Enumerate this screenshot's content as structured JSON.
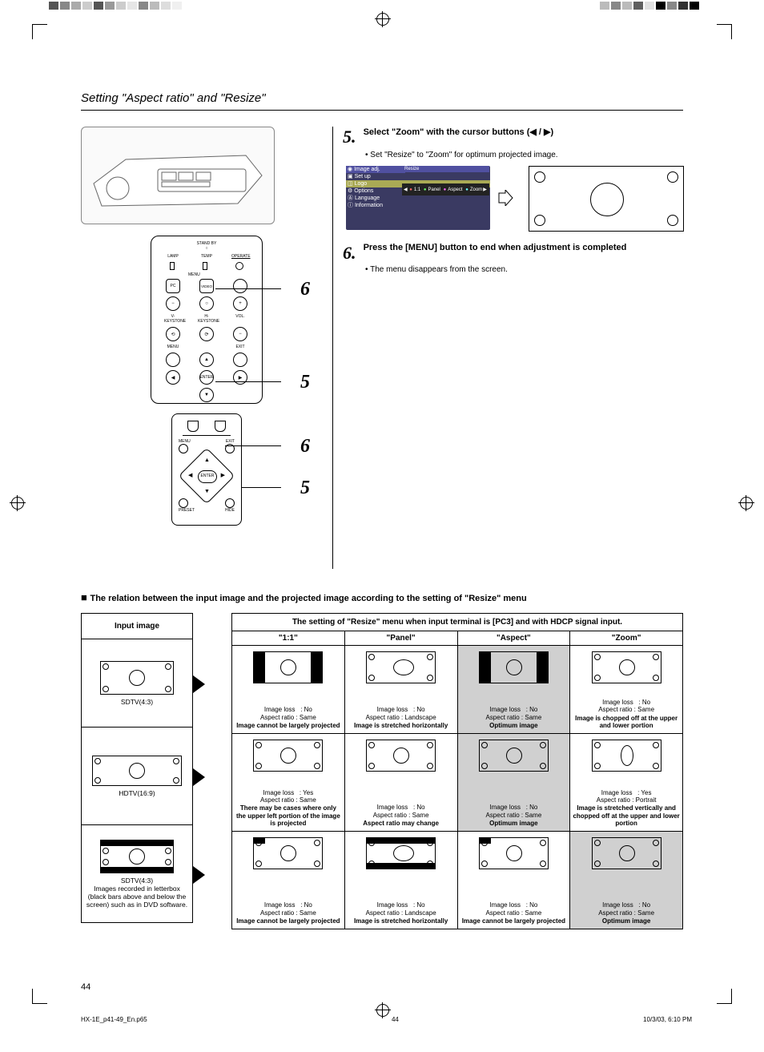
{
  "section_title": "Setting \"Aspect ratio\" and \"Resize\"",
  "step5": {
    "title": "Select \"Zoom\" with the cursor buttons (◀ / ▶)",
    "bullet": "Set \"Resize\" to \"Zoom\" for optimum projected image."
  },
  "step6": {
    "title": "Press the [MENU] button to end when adjustment is completed",
    "bullet": "The menu disappears from the screen."
  },
  "menu": {
    "items": [
      "Image adj.",
      "Set up",
      "Logo",
      "Options",
      "Language",
      "Information"
    ],
    "right_label": "Resize",
    "opts": [
      "1:1",
      "Panel",
      "Aspect",
      "Zoom"
    ]
  },
  "panel_labels": {
    "standby": "STAND BY",
    "lamp": "LAMP",
    "temp": "TEMP",
    "operate": "OPERATE",
    "menu": "MENU",
    "pc": "PC",
    "video": "VIDEO",
    "vkey": "V-KEYSTONE",
    "hkey": "H-KEYSTONE",
    "vol": "VOL.",
    "menul": "MENU",
    "exit": "EXIT",
    "enter": "ENTER"
  },
  "remote_labels": {
    "menu": "MENU",
    "exit": "EXIT",
    "enter": "ENTER",
    "preset": "PRESET",
    "hide": "HIDE"
  },
  "callouts": {
    "c6": "6",
    "c5": "5"
  },
  "relation_heading": "The relation between the input image and the projected image according to the setting of \"Resize\" menu",
  "table": {
    "input_header": "Input image",
    "main_header": "The setting of \"Resize\" menu when input terminal is [PC3] and with HDCP signal input.",
    "cols": [
      "\"1:1\"",
      "\"Panel\"",
      "\"Aspect\"",
      "\"Zoom\""
    ],
    "rows": [
      {
        "input_label": "SDTV(4:3)",
        "cells": [
          {
            "loss": "No",
            "ratio": "Same",
            "note": "Image cannot be largely projected",
            "hl": false,
            "img": "pillar"
          },
          {
            "loss": "No",
            "ratio": "Landscape",
            "note": "Image is stretched horizontally",
            "hl": false,
            "img": "oval"
          },
          {
            "loss": "No",
            "ratio": "Same",
            "note": "Optimum image",
            "hl": true,
            "img": "pillar"
          },
          {
            "loss": "No",
            "ratio": "Same",
            "note": "Image is chopped off at the upper and lower portion",
            "hl": false,
            "img": "crop"
          }
        ]
      },
      {
        "input_label": "HDTV(16:9)",
        "cells": [
          {
            "loss": "Yes",
            "ratio": "Same",
            "note": "There may be cases where only the upper left portion of the image is projected",
            "hl": false,
            "img": "plain"
          },
          {
            "loss": "No",
            "ratio": "Same",
            "note": "Aspect ratio may change",
            "hl": false,
            "img": "plain"
          },
          {
            "loss": "No",
            "ratio": "Same",
            "note": "Optimum image",
            "hl": true,
            "img": "plain"
          },
          {
            "loss": "Yes",
            "ratio": "Portrait",
            "note": "Image is stretched vertically and chopped off at the upper and lower portion",
            "hl": false,
            "img": "tall"
          }
        ]
      },
      {
        "input_label": "SDTV(4:3)\nImages recorded in letterbox (black bars above and below the screen) such as in DVD software.",
        "cells": [
          {
            "loss": "No",
            "ratio": "Same",
            "note": "Image cannot be largely projected",
            "hl": false,
            "img": "letterpillar"
          },
          {
            "loss": "No",
            "ratio": "Landscape",
            "note": "Image is stretched horizontally",
            "hl": false,
            "img": "letteroval"
          },
          {
            "loss": "No",
            "ratio": "Same",
            "note": "Image cannot be largely projected",
            "hl": false,
            "img": "letterpillar"
          },
          {
            "loss": "No",
            "ratio": "Same",
            "note": "Optimum image",
            "hl": true,
            "img": "plain"
          }
        ]
      }
    ]
  },
  "page_number": "44",
  "footer": {
    "file": "HX-1E_p41-49_En.p65",
    "pg": "44",
    "date": "10/3/03, 6:10 PM"
  }
}
